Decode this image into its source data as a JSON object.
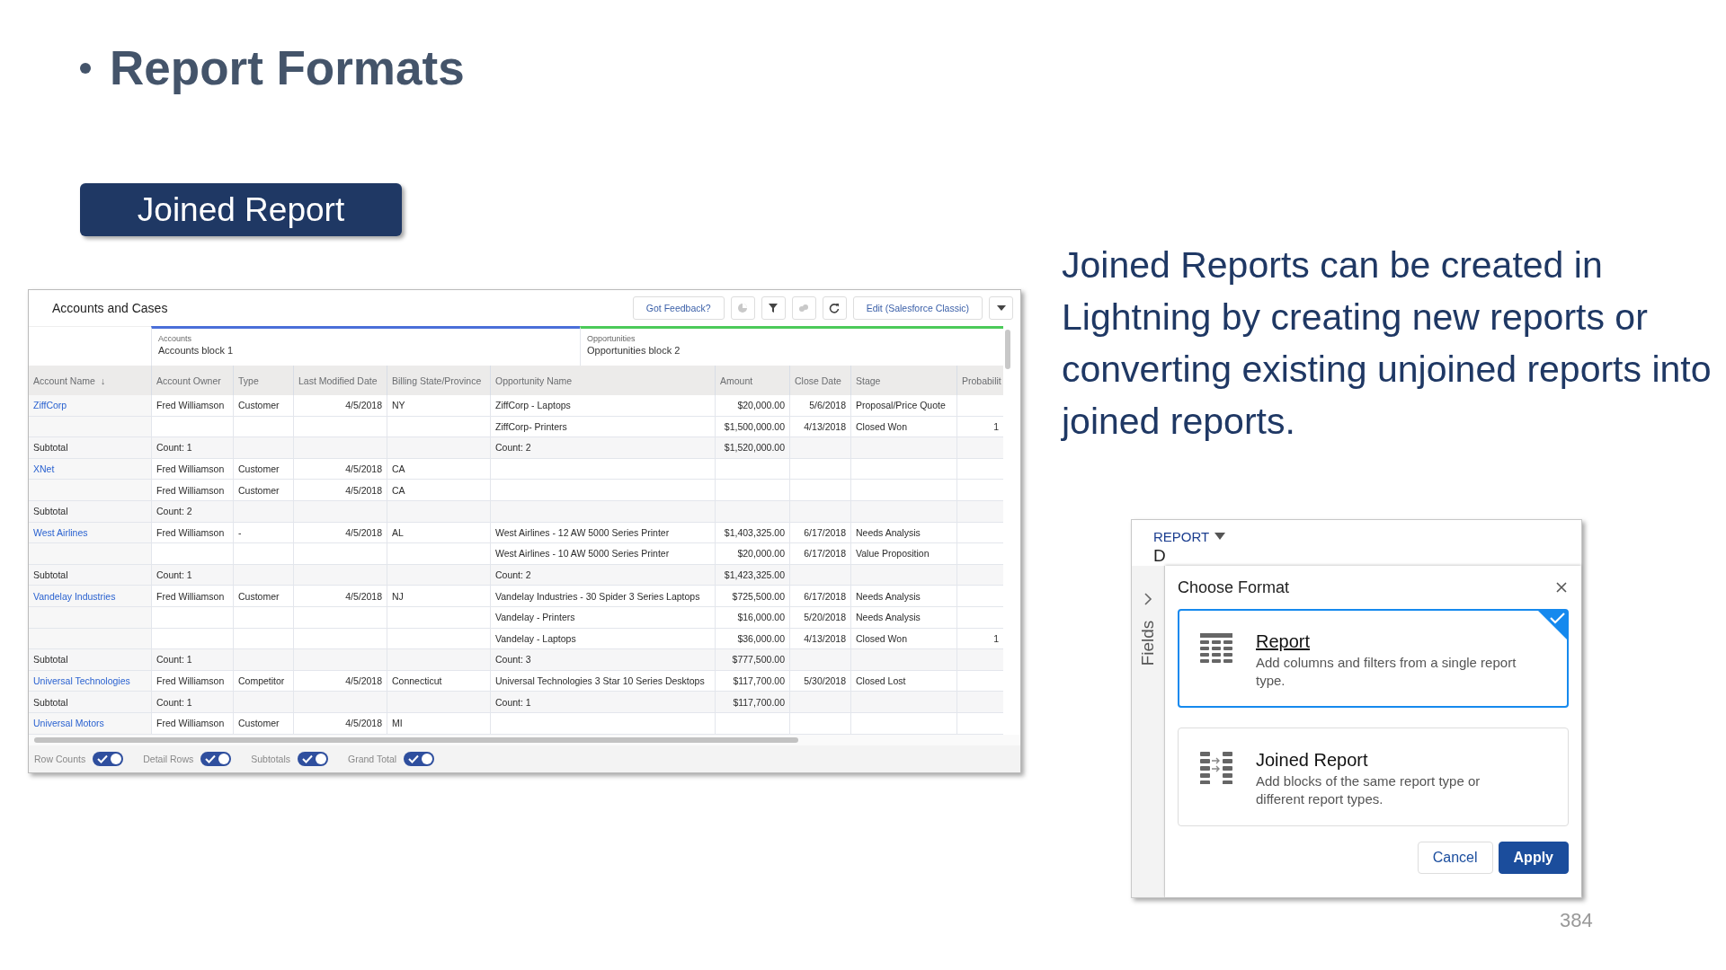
{
  "slide": {
    "title": "Report Formats",
    "badge": "Joined Report",
    "body": "Joined Reports can be created in Lightning by creating new reports or converting existing unjoined reports into joined reports.",
    "page_number": "384"
  },
  "report": {
    "title": "Accounts and Cases",
    "toolbar": [
      {
        "kind": "text",
        "label": "Got Feedback?"
      },
      {
        "kind": "chart",
        "disabled": true
      },
      {
        "kind": "filter",
        "disabled": false
      },
      {
        "kind": "link",
        "disabled": true
      },
      {
        "kind": "refresh",
        "disabled": false
      },
      {
        "kind": "text",
        "label": "Edit (Salesforce Classic)"
      },
      {
        "kind": "caret",
        "disabled": false
      }
    ],
    "blocks": [
      {
        "type": "Accounts",
        "name": "Accounts block 1",
        "color": "#4a6fd9"
      },
      {
        "type": "Opportunities",
        "name": "Opportunities block 2",
        "color": "#4bca59"
      }
    ],
    "columns": [
      "Account Name",
      "Account Owner",
      "Type",
      "Last Modified Date",
      "Billing State/Province",
      "Opportunity Name",
      "Amount",
      "Close Date",
      "Stage",
      "Probabilit"
    ],
    "sort_mark": "↓",
    "rows": [
      {
        "kind": "detail",
        "account": "ZiffCorp",
        "owner": "Fred Williamson",
        "type": "Customer",
        "date": "4/5/2018",
        "state": "NY",
        "opportunity": "ZiffCorp - Laptops",
        "amount": "$20,000.00",
        "close": "5/6/2018",
        "stage": "Proposal/Price Quote"
      },
      {
        "kind": "detail",
        "opportunity": "ZiffCorp- Printers",
        "amount": "$1,500,000.00",
        "close": "4/13/2018",
        "stage": "Closed Won",
        "probability": "1"
      },
      {
        "kind": "subtotal",
        "account": "Subtotal",
        "owner": "Count: 1",
        "opportunity": "Count: 2",
        "amount": "$1,520,000.00"
      },
      {
        "kind": "detail",
        "account": "XNet",
        "owner": "Fred Williamson",
        "type": "Customer",
        "date": "4/5/2018",
        "state": "CA"
      },
      {
        "kind": "detail",
        "owner": "Fred Williamson",
        "type": "Customer",
        "date": "4/5/2018",
        "state": "CA"
      },
      {
        "kind": "subtotal",
        "account": "Subtotal",
        "owner": "Count: 2"
      },
      {
        "kind": "detail",
        "account": "West Airlines",
        "owner": "Fred Williamson",
        "type": "-",
        "date": "4/5/2018",
        "state": "AL",
        "opportunity": "West Airlines - 12 AW 5000 Series Printer",
        "amount": "$1,403,325.00",
        "close": "6/17/2018",
        "stage": "Needs Analysis"
      },
      {
        "kind": "detail",
        "opportunity": "West Airlines - 10 AW 5000 Series Printer",
        "amount": "$20,000.00",
        "close": "6/17/2018",
        "stage": "Value Proposition"
      },
      {
        "kind": "subtotal",
        "account": "Subtotal",
        "owner": "Count: 1",
        "opportunity": "Count: 2",
        "amount": "$1,423,325.00"
      },
      {
        "kind": "detail",
        "account": "Vandelay Industries",
        "owner": "Fred Williamson",
        "type": "Customer",
        "date": "4/5/2018",
        "state": "NJ",
        "opportunity": "Vandelay Industries - 30 Spider 3 Series Laptops",
        "amount": "$725,500.00",
        "close": "6/17/2018",
        "stage": "Needs Analysis"
      },
      {
        "kind": "detail",
        "opportunity": "Vandelay - Printers",
        "amount": "$16,000.00",
        "close": "5/20/2018",
        "stage": "Needs Analysis"
      },
      {
        "kind": "detail",
        "opportunity": "Vandelay - Laptops",
        "amount": "$36,000.00",
        "close": "4/13/2018",
        "stage": "Closed Won",
        "probability": "1"
      },
      {
        "kind": "subtotal",
        "account": "Subtotal",
        "owner": "Count: 1",
        "opportunity": "Count: 3",
        "amount": "$777,500.00"
      },
      {
        "kind": "detail",
        "account": "Universal Technologies",
        "owner": "Fred Williamson",
        "type": "Competitor",
        "date": "4/5/2018",
        "state": "Connecticut",
        "opportunity": "Universal Technologies 3 Star 10 Series Desktops",
        "amount": "$117,700.00",
        "close": "5/30/2018",
        "stage": "Closed Lost"
      },
      {
        "kind": "subtotal",
        "account": "Subtotal",
        "owner": "Count: 1",
        "opportunity": "Count: 1",
        "amount": "$117,700.00"
      },
      {
        "kind": "detail",
        "account": "Universal Motors",
        "owner": "Fred Williamson",
        "type": "Customer",
        "date": "4/5/2018",
        "state": "MI"
      }
    ],
    "toggles": [
      {
        "label": "Row Counts",
        "on": true
      },
      {
        "label": "Detail Rows",
        "on": true
      },
      {
        "label": "Subtotals",
        "on": true
      },
      {
        "label": "Grand Total",
        "on": true
      }
    ]
  },
  "format_dialog": {
    "menu": "REPORT",
    "report_title": "D",
    "sidebar_label": "Fields",
    "title": "Choose Format",
    "options": [
      {
        "kind": "table",
        "title": "Report",
        "description": "Add columns and filters from a single report type.",
        "selected": true
      },
      {
        "kind": "joined",
        "title": "Joined Report",
        "description": "Add blocks of the same report type or different report types.",
        "selected": false
      }
    ],
    "buttons": [
      {
        "label": "Cancel",
        "primary": false
      },
      {
        "label": "Apply",
        "primary": true
      }
    ]
  }
}
